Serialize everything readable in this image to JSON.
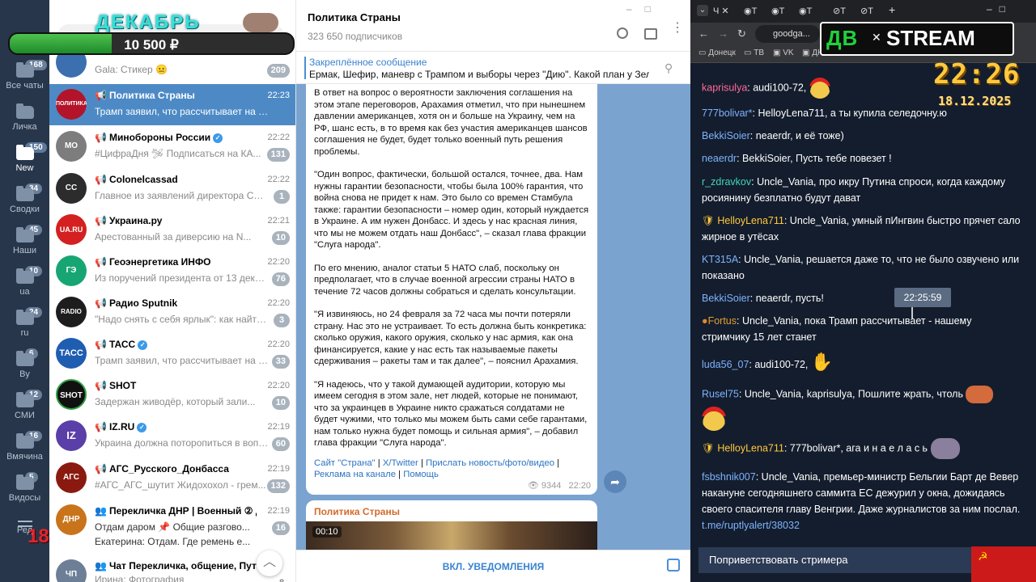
{
  "rail": {
    "folders": [
      {
        "label": "Все чаты",
        "badge": "168"
      },
      {
        "label": "Личка",
        "badge": ""
      },
      {
        "label": "New",
        "badge": "150"
      },
      {
        "label": "Сводки",
        "badge": "34"
      },
      {
        "label": "Наши",
        "badge": "45"
      },
      {
        "label": "ua",
        "badge": "10"
      },
      {
        "label": "ru",
        "badge": "24"
      },
      {
        "label": "By",
        "badge": "6"
      },
      {
        "label": "СМИ",
        "badge": "12"
      },
      {
        "label": "Вмячина",
        "badge": "16"
      },
      {
        "label": "Видосы",
        "badge": "5"
      },
      {
        "label": "Ред",
        "badge": ""
      }
    ],
    "age_label": "18+"
  },
  "overlay": {
    "month": "ДЕКАБРЬ",
    "money": "10 500 ₽",
    "goal_progress": 0.36
  },
  "chatlist": {
    "rows": [
      {
        "name": "",
        "preview": "Gala: Стикер 😐",
        "time": "",
        "count": "209",
        "avatar_text": "",
        "avatar_color": "#3b6fb0",
        "verified": false,
        "channel": false
      },
      {
        "name": "Политика Страны",
        "preview": "Трамп заявил, что рассчитывает на быст...",
        "time": "22:23",
        "count": "",
        "avatar_text": "ПОЛИТИКА",
        "avatar_color": "#b3142a",
        "verified": false,
        "channel": true
      },
      {
        "name": "Минобороны России",
        "preview": "#ЦифраДня 🛩 Подписаться на КА...",
        "time": "22:22",
        "count": "131",
        "avatar_text": "МО",
        "avatar_color": "#7d7d7d",
        "verified": true,
        "channel": true
      },
      {
        "name": "Colonelcassad",
        "preview": "Главное из заявлений директора СВР Р...",
        "time": "22:22",
        "count": "1",
        "avatar_text": "CC",
        "avatar_color": "#2c2c2c",
        "verified": false,
        "channel": true
      },
      {
        "name": "Украина.ру",
        "preview": "Арестованный за диверсию на N...",
        "time": "22:21",
        "count": "10",
        "avatar_text": "UA.RU",
        "avatar_color": "#d42020",
        "verified": false,
        "channel": true
      },
      {
        "name": "Геоэнергетика ИНФО",
        "preview": "Из поручений президента от 13 декаб...",
        "time": "22:20",
        "count": "76",
        "avatar_text": "ГЭ",
        "avatar_color": "#17a673",
        "verified": false,
        "channel": true
      },
      {
        "name": "Радио Sputnik",
        "preview": "\"Надо снять с себя ярлык\": как найти ...",
        "time": "22:20",
        "count": "3",
        "avatar_text": "RADIO",
        "avatar_color": "#1d1d1d",
        "verified": false,
        "channel": true
      },
      {
        "name": "ТАСС",
        "preview": "Трамп заявил, что рассчитывает на б...",
        "time": "22:20",
        "count": "33",
        "avatar_text": "ТАСС",
        "avatar_color": "#1f5db1",
        "verified": true,
        "channel": true
      },
      {
        "name": "SHOT",
        "preview": "Задержан живодёр, который зали...",
        "time": "22:20",
        "count": "10",
        "avatar_text": "SHOT",
        "avatar_color": "#111111",
        "verified": false,
        "channel": true
      },
      {
        "name": "IZ.RU",
        "preview": "Украина должна поторопиться в вопро...",
        "time": "22:19",
        "count": "60",
        "avatar_text": "IZ",
        "avatar_color": "#5a3fa8",
        "verified": true,
        "channel": true
      },
      {
        "name": "АГС_Русского_Донбасса",
        "preview": "#АГС_АГС_шутит Жидохохол - грем...",
        "time": "22:19",
        "count": "132",
        "avatar_text": "АГС",
        "avatar_color": "#8a1a10",
        "verified": false,
        "channel": true
      },
      {
        "name": "Перекличка ДНР | Военный ② До...",
        "preview": "Отдам даром 📌 Общие разгово...",
        "preview2": "Екатерина: Отдам. Где ремень е...",
        "time": "22:19",
        "count": "16",
        "avatar_text": "ДНР",
        "avatar_color": "#c9731a",
        "verified": false,
        "channel": false
      },
      {
        "name": "Чат Перекличка, общение, Путил...",
        "preview": "Ирина: Фотография",
        "time": "",
        "count": "8",
        "avatar_text": "ЧП",
        "avatar_color": "#6d7f96",
        "verified": false,
        "channel": false
      }
    ]
  },
  "chat": {
    "title": "Политика Страны",
    "subscribers": "323 650 подписчиков",
    "pinned_label": "Закреплённое сообщение",
    "pinned_text": "Ермак, Шефир, маневр с Трампом и выборы через \"Дию\". Какой план у Зеленс...",
    "paragraphs": [
      "В ответ на вопрос о вероятности заключения соглашения на этом этапе переговоров, Арахамия отметил, что при нынешнем давлении американцев, хотя он и больше на Украину, чем на РФ, шанс есть, в то время как без участия американцев шансов соглашения не будет, будет только военный путь решения проблемы.",
      "\"Один вопрос, фактически, большой остался, точнее, два. Нам нужны гарантии безопасности, чтобы была 100% гарантия, что война снова не придет к нам. Это было со времен Стамбула также: гарантии безопасности – номер один, который нуждается в Украине. А им нужен Донбасс. И здесь у нас красная линия, что мы не можем отдать наш Донбасс\", – сказал глава фракции \"Слуга народа\".",
      "По его мнению, аналог статьи 5 НАТО слаб, поскольку он предполагает, что в случае военной агрессии страны НАТО в течение 72 часов должны собраться и сделать консультации.",
      "\"Я извиняюсь, но 24 февраля за 72 часа мы почти потеряли страну. Нас это не устраивает. То есть должна быть конкретика: сколько оружия, какого оружия, сколько у нас армия, как она финансируется, какие у нас есть так называемые пакеты сдерживания – ракеты там и так далее\", – пояснил Арахамия.",
      "\"Я надеюсь, что у такой думающей аудитории, которую мы имеем сегодня в этом зале, нет людей, которые не понимают, что за украинцев в Украине никто сражаться солдатами не будет чужими, что только мы можем быть сами себе гарантами, нам только нужна будет помощь и сильная армия\", – добавил глава фракции \"Слуга народа\"."
    ],
    "links": [
      "Сайт \"Страна\"",
      "X/Twitter",
      "Прислать новость/фото/видео",
      "Реклама на канале",
      "Помощь"
    ],
    "views": "9344",
    "time": "22:20",
    "next_author": "Политика Страны",
    "video_time": "00:10",
    "notify_label": "ВКЛ. УВЕДОМЛЕНИЯ"
  },
  "browser": {
    "tabs": [
      "Ч",
      "Т",
      "Т",
      "Т",
      "Т",
      "Т"
    ],
    "url": "goodga...",
    "bookmarks": [
      "Донецк",
      "ТВ",
      "VK",
      "ДН"
    ],
    "logo_left": "ДВ",
    "logo_right": "STREAM",
    "clock": "22:26",
    "date": "18.12.2025",
    "tooltip": "22:25:59",
    "greet": "Поприветствовать стримера",
    "messages": [
      {
        "nick": "kaprisulya",
        "text": "audi100-72,"
      },
      {
        "nick": "777bolivar*",
        "text": "HelloyLena711, а ты купила селедочну.ю"
      },
      {
        "nick": "BekkiSoier",
        "text": "neaerdr, и её тоже)"
      },
      {
        "nick": "neaerdr",
        "text": "BekkiSoier, Пусть тебе повезет !"
      },
      {
        "nick": "r_zdravkov",
        "text": "Uncle_Vania, про икру Путина спроси, когда каждому росиянину безплатно будут дават"
      },
      {
        "nick": "HelloyLena711",
        "text": "Uncle_Vania, умный пИнгвин быстро прячет сало жирное в утёсах"
      },
      {
        "nick": "KT315A",
        "text": "Uncle_Vania, решается даже то, что не было озвучено или показано"
      },
      {
        "nick": "BekkiSoier",
        "text": "neaerdr, пусть!"
      },
      {
        "nick": "Fortus",
        "text": "Uncle_Vania, пока Трамп рассчитывает - нашему стримчику 15 лет станет"
      },
      {
        "nick": "luda56_07",
        "text": "audi100-72,"
      },
      {
        "nick": "Rusel75",
        "text": "Uncle_Vania, kaprisulya, Пошлите жрать, чтоль"
      },
      {
        "nick": "HelloyLena711",
        "text": "777bolivar*, ага и н а е л а с ь"
      },
      {
        "nick": "fsbshnik007",
        "text": "Uncle_Vania, премьер-министр Бельгии Барт де Вевер накануне сегодняшнего саммита ЕС дежурил у окна, дожидаясь своего спасителя главу Венгрии. Даже журналистов за ним послал.",
        "link": "t.me/ruptlyalert/38032"
      }
    ]
  }
}
